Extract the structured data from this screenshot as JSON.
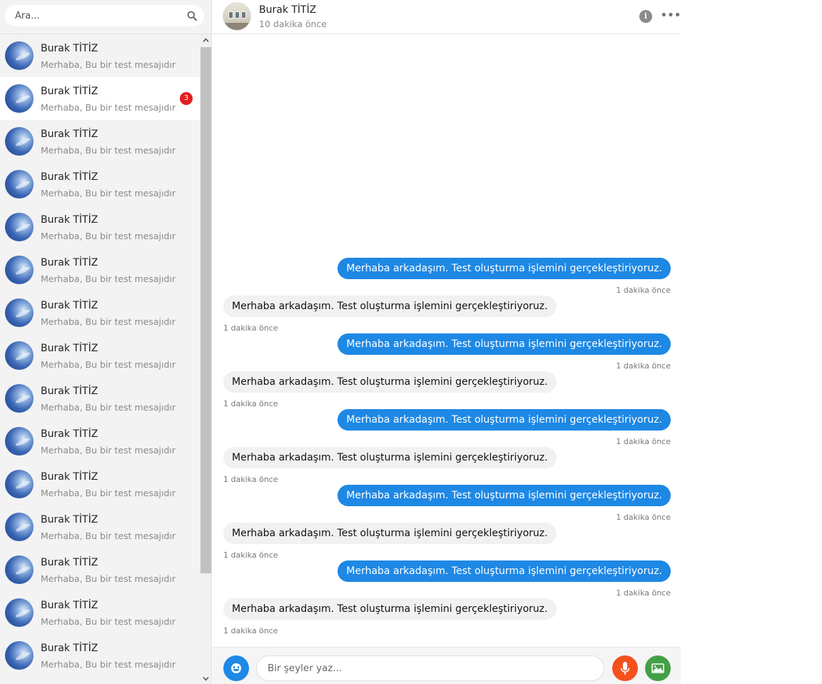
{
  "search": {
    "placeholder": "Ara..."
  },
  "conversations": [
    {
      "name": "Burak TİTİZ",
      "preview": "Merhaba, Bu bir test mesajıdır",
      "unread": "",
      "active": false
    },
    {
      "name": "Burak TİTİZ",
      "preview": "Merhaba, Bu bir test mesajıdır",
      "unread": "3",
      "active": true
    },
    {
      "name": "Burak TİTİZ",
      "preview": "Merhaba, Bu bir test mesajıdır",
      "unread": "",
      "active": false
    },
    {
      "name": "Burak TİTİZ",
      "preview": "Merhaba, Bu bir test mesajıdır",
      "unread": "",
      "active": false
    },
    {
      "name": "Burak TİTİZ",
      "preview": "Merhaba, Bu bir test mesajıdır",
      "unread": "",
      "active": false
    },
    {
      "name": "Burak TİTİZ",
      "preview": "Merhaba, Bu bir test mesajıdır",
      "unread": "",
      "active": false
    },
    {
      "name": "Burak TİTİZ",
      "preview": "Merhaba, Bu bir test mesajıdır",
      "unread": "",
      "active": false
    },
    {
      "name": "Burak TİTİZ",
      "preview": "Merhaba, Bu bir test mesajıdır",
      "unread": "",
      "active": false
    },
    {
      "name": "Burak TİTİZ",
      "preview": "Merhaba, Bu bir test mesajıdır",
      "unread": "",
      "active": false
    },
    {
      "name": "Burak TİTİZ",
      "preview": "Merhaba, Bu bir test mesajıdır",
      "unread": "",
      "active": false
    },
    {
      "name": "Burak TİTİZ",
      "preview": "Merhaba, Bu bir test mesajıdır",
      "unread": "",
      "active": false
    },
    {
      "name": "Burak TİTİZ",
      "preview": "Merhaba, Bu bir test mesajıdır",
      "unread": "",
      "active": false
    },
    {
      "name": "Burak TİTİZ",
      "preview": "Merhaba, Bu bir test mesajıdır",
      "unread": "",
      "active": false
    },
    {
      "name": "Burak TİTİZ",
      "preview": "Merhaba, Bu bir test mesajıdır",
      "unread": "",
      "active": false
    },
    {
      "name": "Burak TİTİZ",
      "preview": "Merhaba, Bu bir test mesajıdır",
      "unread": "",
      "active": false
    }
  ],
  "chat": {
    "contact_name": "Burak TİTİZ",
    "last_seen": "10 dakika önce",
    "info_icon": "info-icon",
    "more_icon": "more-options-icon"
  },
  "messages": [
    {
      "direction": "out",
      "text": "Merhaba arkadaşım. Test oluşturma işlemini gerçekleştiriyoruz.",
      "time": "1 dakika önce"
    },
    {
      "direction": "in",
      "text": "Merhaba arkadaşım. Test oluşturma işlemini gerçekleştiriyoruz.",
      "time": "1 dakika önce"
    },
    {
      "direction": "out",
      "text": "Merhaba arkadaşım. Test oluşturma işlemini gerçekleştiriyoruz.",
      "time": "1 dakika önce"
    },
    {
      "direction": "in",
      "text": "Merhaba arkadaşım. Test oluşturma işlemini gerçekleştiriyoruz.",
      "time": "1 dakika önce"
    },
    {
      "direction": "out",
      "text": "Merhaba arkadaşım. Test oluşturma işlemini gerçekleştiriyoruz.",
      "time": "1 dakika önce"
    },
    {
      "direction": "in",
      "text": "Merhaba arkadaşım. Test oluşturma işlemini gerçekleştiriyoruz.",
      "time": "1 dakika önce"
    },
    {
      "direction": "out",
      "text": "Merhaba arkadaşım. Test oluşturma işlemini gerçekleştiriyoruz.",
      "time": "1 dakika önce"
    },
    {
      "direction": "in",
      "text": "Merhaba arkadaşım. Test oluşturma işlemini gerçekleştiriyoruz.",
      "time": "1 dakika önce"
    },
    {
      "direction": "out",
      "text": "Merhaba arkadaşım. Test oluşturma işlemini gerçekleştiriyoruz.",
      "time": "1 dakika önce"
    },
    {
      "direction": "in",
      "text": "Merhaba arkadaşım. Test oluşturma işlemini gerçekleştiriyoruz.",
      "time": "1 dakika önce"
    }
  ],
  "composer": {
    "placeholder": "Bir şeyler yaz...",
    "emoji_icon": "emoji-icon",
    "mic_icon": "microphone-icon",
    "image_icon": "image-icon"
  },
  "colors": {
    "accent": "#1e88e5",
    "badge": "#e41e1e",
    "mic": "#f4511e",
    "image": "#43a047",
    "sidebar_bg": "#f3f3f3"
  }
}
